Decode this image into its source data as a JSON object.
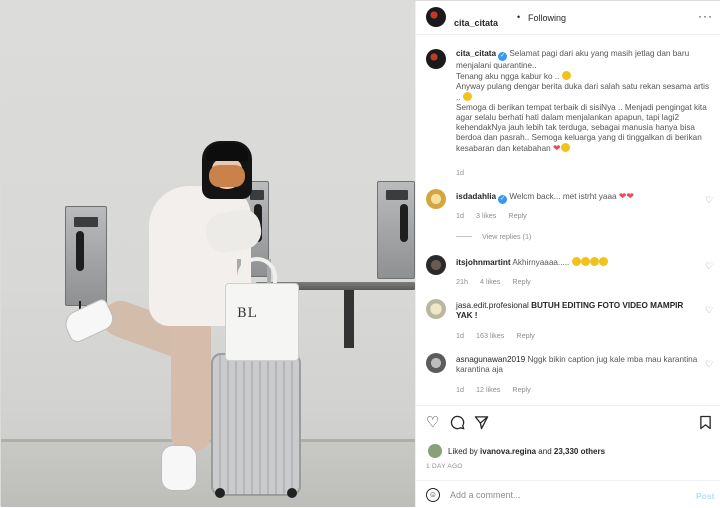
{
  "header": {
    "username": "cita_citata",
    "separator": "•",
    "follow_status": "Following",
    "more": "···"
  },
  "caption": {
    "username": "cita_citata",
    "p1": "Selamat pagi dari aku yang masih jetlag dan baru menjalani quarantine..",
    "p2": "Tenang aku ngga kabur ko ..",
    "p3": "Anyway pulang dengar berita duka dari salah satu rekan sesama artis ..",
    "p4": "Semoga di berikan tempat terbaik di sisiNya .. Menjadi pengingat kita agar selalu berhati hati dalam menjalankan apapun, tapi lagi2 kehendakNya jauh lebih tak terduga, sebagai manusia hanya bisa berdoa dan pasrah.. Semoga keluarga yang di tinggalkan di berikan kesabaran dan ketabahan",
    "time": "1d"
  },
  "comments": [
    {
      "username": "isdadahlia",
      "text": "Welcm back... met istrht yaaa",
      "time": "1d",
      "likes": "3 likes",
      "reply": "Reply",
      "view_replies": "View replies (1)"
    },
    {
      "username": "itsjohnmartint",
      "text": "Akhirnyaaaa.....",
      "time": "21h",
      "likes": "4 likes",
      "reply": "Reply"
    },
    {
      "username": "jasa.edit.profesional",
      "text": "BUTUH EDITING FOTO VIDEO MAMPIR YAK !",
      "time": "1d",
      "likes": "163 likes",
      "reply": "Reply"
    },
    {
      "username": "asnagunawan2019",
      "text": "Nggk bikin caption jug kale mba mau karantina karantina aja",
      "time": "1d",
      "likes": "12 likes",
      "reply": "Reply"
    }
  ],
  "likes_line": {
    "prefix": "Liked by",
    "user": "ivanova.regina",
    "middle": "and",
    "count": "23,330 others"
  },
  "date": "1 DAY AGO",
  "add_comment": {
    "placeholder": "Add a comment...",
    "post": "Post"
  },
  "photo": {
    "bag_text": "BL"
  },
  "colors": {
    "verified": "#3897f0",
    "link": "#b2dffc",
    "heart": "#ed4956"
  },
  "icons": [
    "heart-icon",
    "comment-icon",
    "share-icon",
    "bookmark-icon",
    "emoji-icon",
    "verified-icon",
    "more-icon"
  ]
}
